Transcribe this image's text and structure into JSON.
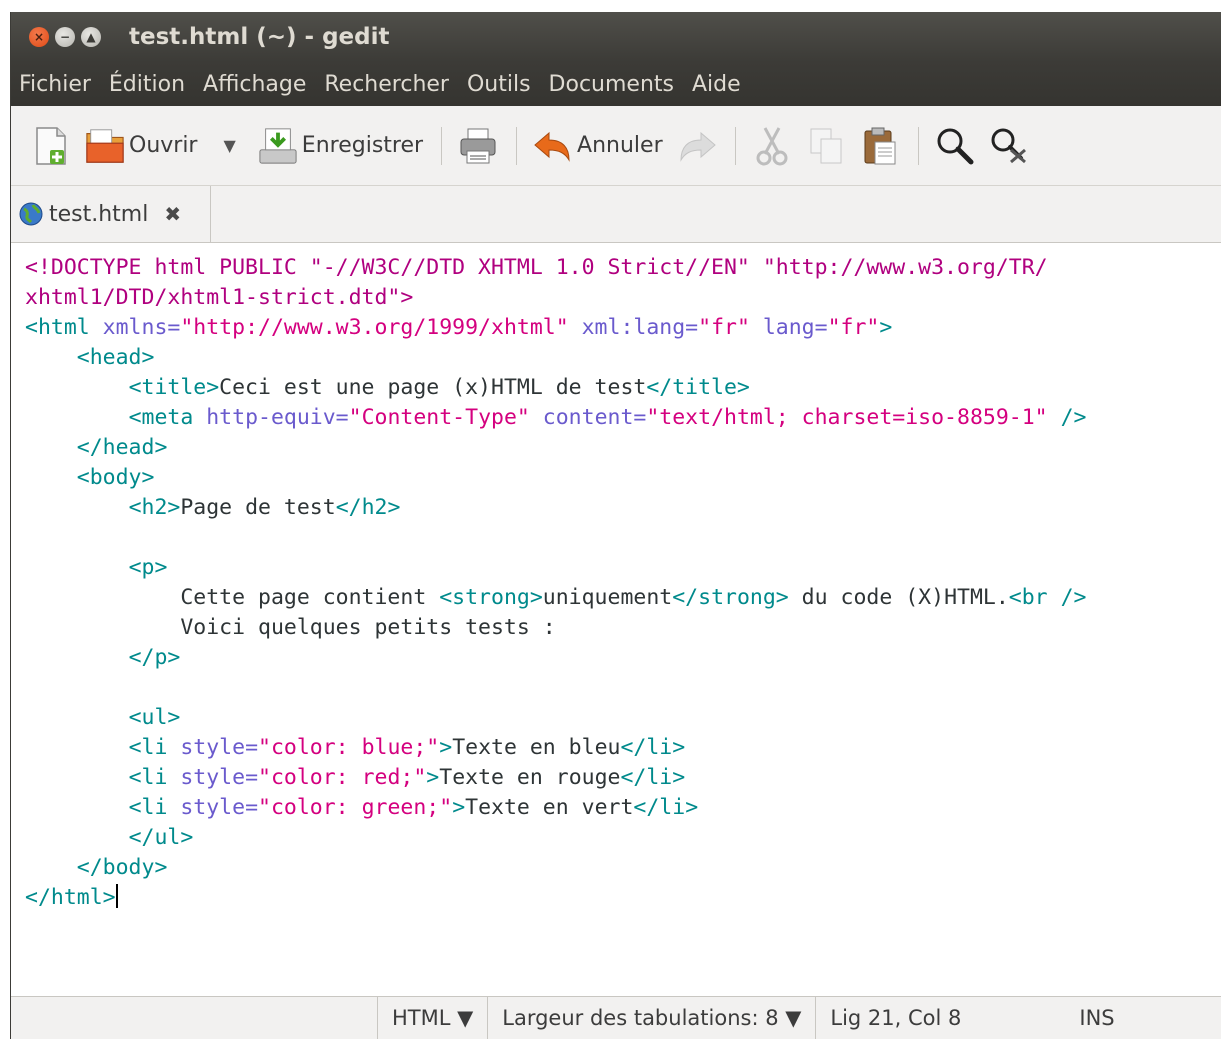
{
  "window": {
    "title": "test.html (~) - gedit",
    "buttons": {
      "close": "×",
      "minimize": "−",
      "maximize": "▲"
    }
  },
  "menu": [
    "Fichier",
    "Édition",
    "Affichage",
    "Rechercher",
    "Outils",
    "Documents",
    "Aide"
  ],
  "toolbar": {
    "open_label": "Ouvrir",
    "save_label": "Enregistrer",
    "undo_label": "Annuler",
    "dropdown_arrow": "▼",
    "icons": [
      "new-document-icon",
      "open-folder-icon",
      "save-icon",
      "print-icon",
      "undo-icon",
      "redo-icon",
      "cut-icon",
      "copy-icon",
      "paste-icon",
      "search-icon",
      "replace-icon"
    ]
  },
  "tab": {
    "label": "test.html",
    "close": "✖"
  },
  "code_lines": [
    [
      [
        "doc",
        "<!DOCTYPE html PUBLIC \"-//W3C//DTD XHTML 1.0 Strict//EN\" \"http://www.w3.org/TR/"
      ]
    ],
    [
      [
        "doc",
        "xhtml1/DTD/xhtml1-strict.dtd\">"
      ]
    ],
    [
      [
        "tag",
        "<html "
      ],
      [
        "attr",
        "xmlns="
      ],
      [
        "val",
        "\"http://www.w3.org/1999/xhtml\""
      ],
      [
        "attr",
        " xml:lang="
      ],
      [
        "val",
        "\"fr\""
      ],
      [
        "attr",
        " lang="
      ],
      [
        "val",
        "\"fr\""
      ],
      [
        "tag",
        ">"
      ]
    ],
    [
      [
        "txt",
        "    "
      ],
      [
        "tag",
        "<head>"
      ]
    ],
    [
      [
        "txt",
        "        "
      ],
      [
        "tag",
        "<title>"
      ],
      [
        "txt",
        "Ceci est une page (x)HTML de test"
      ],
      [
        "tag",
        "</title>"
      ]
    ],
    [
      [
        "txt",
        "        "
      ],
      [
        "tag",
        "<meta "
      ],
      [
        "attr",
        "http-equiv="
      ],
      [
        "val",
        "\"Content-Type\""
      ],
      [
        "attr",
        " content="
      ],
      [
        "val",
        "\"text/html; charset=iso-8859-1\""
      ],
      [
        "tag",
        " />"
      ]
    ],
    [
      [
        "txt",
        "    "
      ],
      [
        "tag",
        "</head>"
      ]
    ],
    [
      [
        "txt",
        "    "
      ],
      [
        "tag",
        "<body>"
      ]
    ],
    [
      [
        "txt",
        "        "
      ],
      [
        "tag",
        "<h2>"
      ],
      [
        "txt",
        "Page de test"
      ],
      [
        "tag",
        "</h2>"
      ]
    ],
    [
      [
        "txt",
        ""
      ]
    ],
    [
      [
        "txt",
        "        "
      ],
      [
        "tag",
        "<p>"
      ]
    ],
    [
      [
        "txt",
        "            Cette page contient "
      ],
      [
        "tag",
        "<strong>"
      ],
      [
        "txt",
        "uniquement"
      ],
      [
        "tag",
        "</strong>"
      ],
      [
        "txt",
        " du code (X)HTML."
      ],
      [
        "tag",
        "<br />"
      ]
    ],
    [
      [
        "txt",
        "            Voici quelques petits tests :"
      ]
    ],
    [
      [
        "txt",
        "        "
      ],
      [
        "tag",
        "</p>"
      ]
    ],
    [
      [
        "txt",
        ""
      ]
    ],
    [
      [
        "txt",
        "        "
      ],
      [
        "tag",
        "<ul>"
      ]
    ],
    [
      [
        "txt",
        "        "
      ],
      [
        "tag",
        "<li "
      ],
      [
        "attr",
        "style="
      ],
      [
        "val",
        "\"color: blue;\""
      ],
      [
        "tag",
        ">"
      ],
      [
        "txt",
        "Texte en bleu"
      ],
      [
        "tag",
        "</li>"
      ]
    ],
    [
      [
        "txt",
        "        "
      ],
      [
        "tag",
        "<li "
      ],
      [
        "attr",
        "style="
      ],
      [
        "val",
        "\"color: red;\""
      ],
      [
        "tag",
        ">"
      ],
      [
        "txt",
        "Texte en rouge"
      ],
      [
        "tag",
        "</li>"
      ]
    ],
    [
      [
        "txt",
        "        "
      ],
      [
        "tag",
        "<li "
      ],
      [
        "attr",
        "style="
      ],
      [
        "val",
        "\"color: green;\""
      ],
      [
        "tag",
        ">"
      ],
      [
        "txt",
        "Texte en vert"
      ],
      [
        "tag",
        "</li>"
      ]
    ],
    [
      [
        "txt",
        "        "
      ],
      [
        "tag",
        "</ul>"
      ]
    ],
    [
      [
        "txt",
        "    "
      ],
      [
        "tag",
        "</body>"
      ]
    ],
    [
      [
        "tag",
        "</html>"
      ]
    ]
  ],
  "statusbar": {
    "language": "HTML ▼",
    "tab_width": "Largeur des tabulations: 8 ▼",
    "position": "Lig 21, Col 8",
    "mode": "INS"
  }
}
